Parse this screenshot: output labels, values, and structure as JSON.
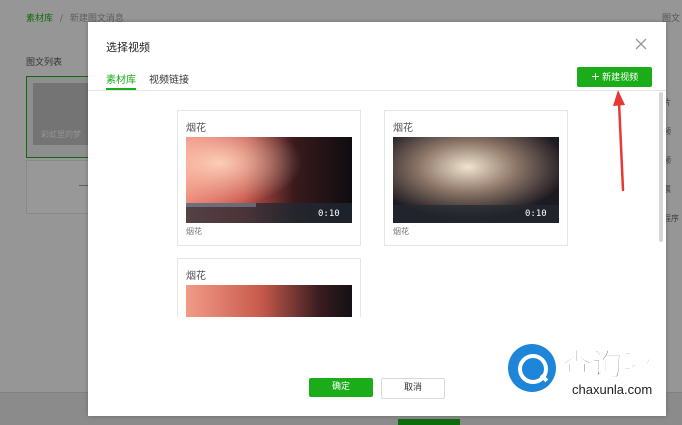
{
  "background": {
    "breadcrumb_link": "素材库",
    "breadcrumb_sep": "/",
    "breadcrumb_current": "新建图文消息",
    "top_right_text": "图文",
    "list_title": "图文列表",
    "card_text": "彩虹里的梦",
    "right_column": [
      "片",
      "频",
      "频",
      "票",
      "程序"
    ]
  },
  "modal": {
    "title": "选择视频",
    "tabs": [
      {
        "label": "素材库",
        "active": true
      },
      {
        "label": "视频链接",
        "active": false
      }
    ],
    "new_video_label": "新建视频",
    "videos": [
      {
        "title": "烟花",
        "duration": "0:10",
        "caption": "烟花"
      },
      {
        "title": "烟花",
        "duration": "0:10",
        "caption": "烟花"
      },
      {
        "title": "烟花",
        "duration": "",
        "caption": ""
      }
    ],
    "confirm_label": "确定",
    "cancel_label": "取消"
  },
  "watermark": {
    "cn": "查询啦",
    "en": "chaxunla.com"
  },
  "colors": {
    "accent": "#1aad19",
    "annotation": "#e53935"
  }
}
